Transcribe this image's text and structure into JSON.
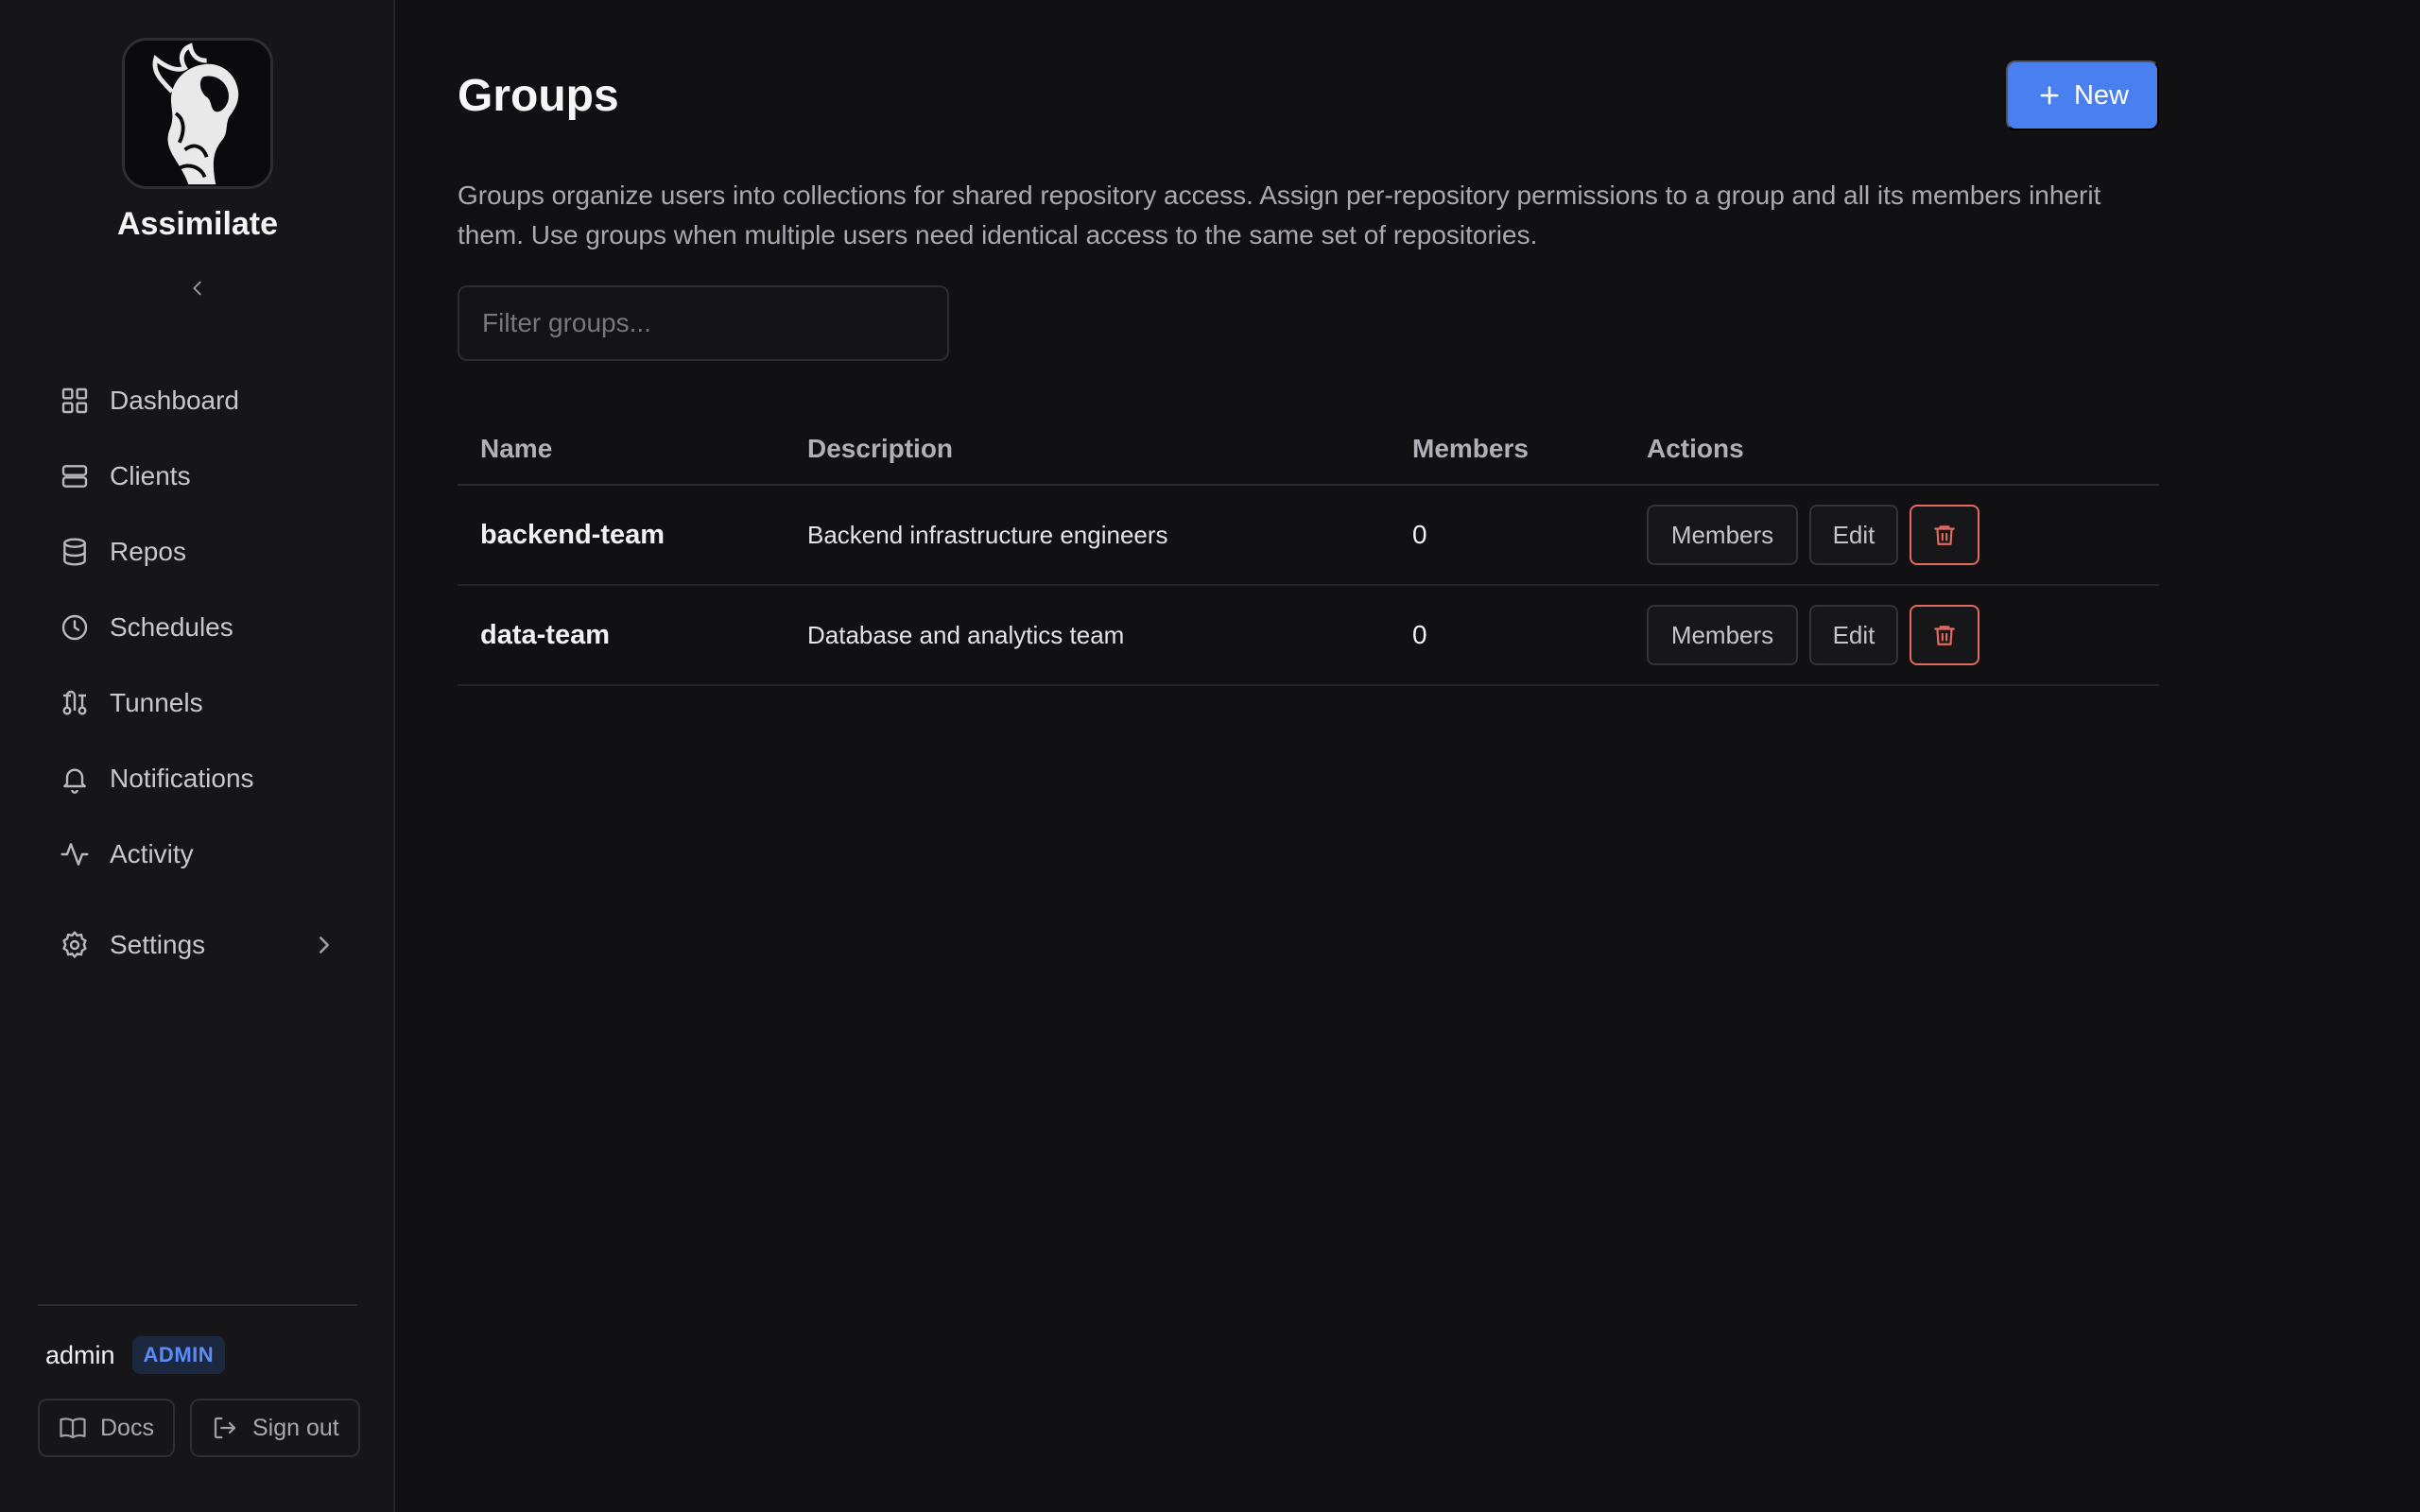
{
  "brand": {
    "name": "Assimilate"
  },
  "nav": {
    "items": [
      {
        "label": "Dashboard",
        "icon": "dashboard-icon"
      },
      {
        "label": "Clients",
        "icon": "server-icon"
      },
      {
        "label": "Repos",
        "icon": "database-icon"
      },
      {
        "label": "Schedules",
        "icon": "clock-icon"
      },
      {
        "label": "Tunnels",
        "icon": "tunnel-icon"
      },
      {
        "label": "Notifications",
        "icon": "bell-icon"
      },
      {
        "label": "Activity",
        "icon": "activity-icon"
      }
    ],
    "settings": {
      "label": "Settings",
      "icon": "gear-icon"
    }
  },
  "user": {
    "name": "admin",
    "role": "ADMIN"
  },
  "footer": {
    "docs_label": "Docs",
    "signout_label": "Sign out"
  },
  "page": {
    "title": "Groups",
    "new_label": "New",
    "description": "Groups organize users into collections for shared repository access. Assign per-repository permissions to a group and all its members inherit them. Use groups when multiple users need identical access to the same set of repositories.",
    "filter_placeholder": "Filter groups..."
  },
  "table": {
    "headers": {
      "name": "Name",
      "description": "Description",
      "members": "Members",
      "actions": "Actions"
    },
    "rows": [
      {
        "name": "backend-team",
        "description": "Backend infrastructure engineers",
        "members": "0"
      },
      {
        "name": "data-team",
        "description": "Database and analytics team",
        "members": "0"
      }
    ],
    "members_btn": "Members",
    "edit_btn": "Edit"
  },
  "colors": {
    "accent": "#4a7ff0",
    "danger": "#e36a5e",
    "badge": "#5b8cf5"
  }
}
